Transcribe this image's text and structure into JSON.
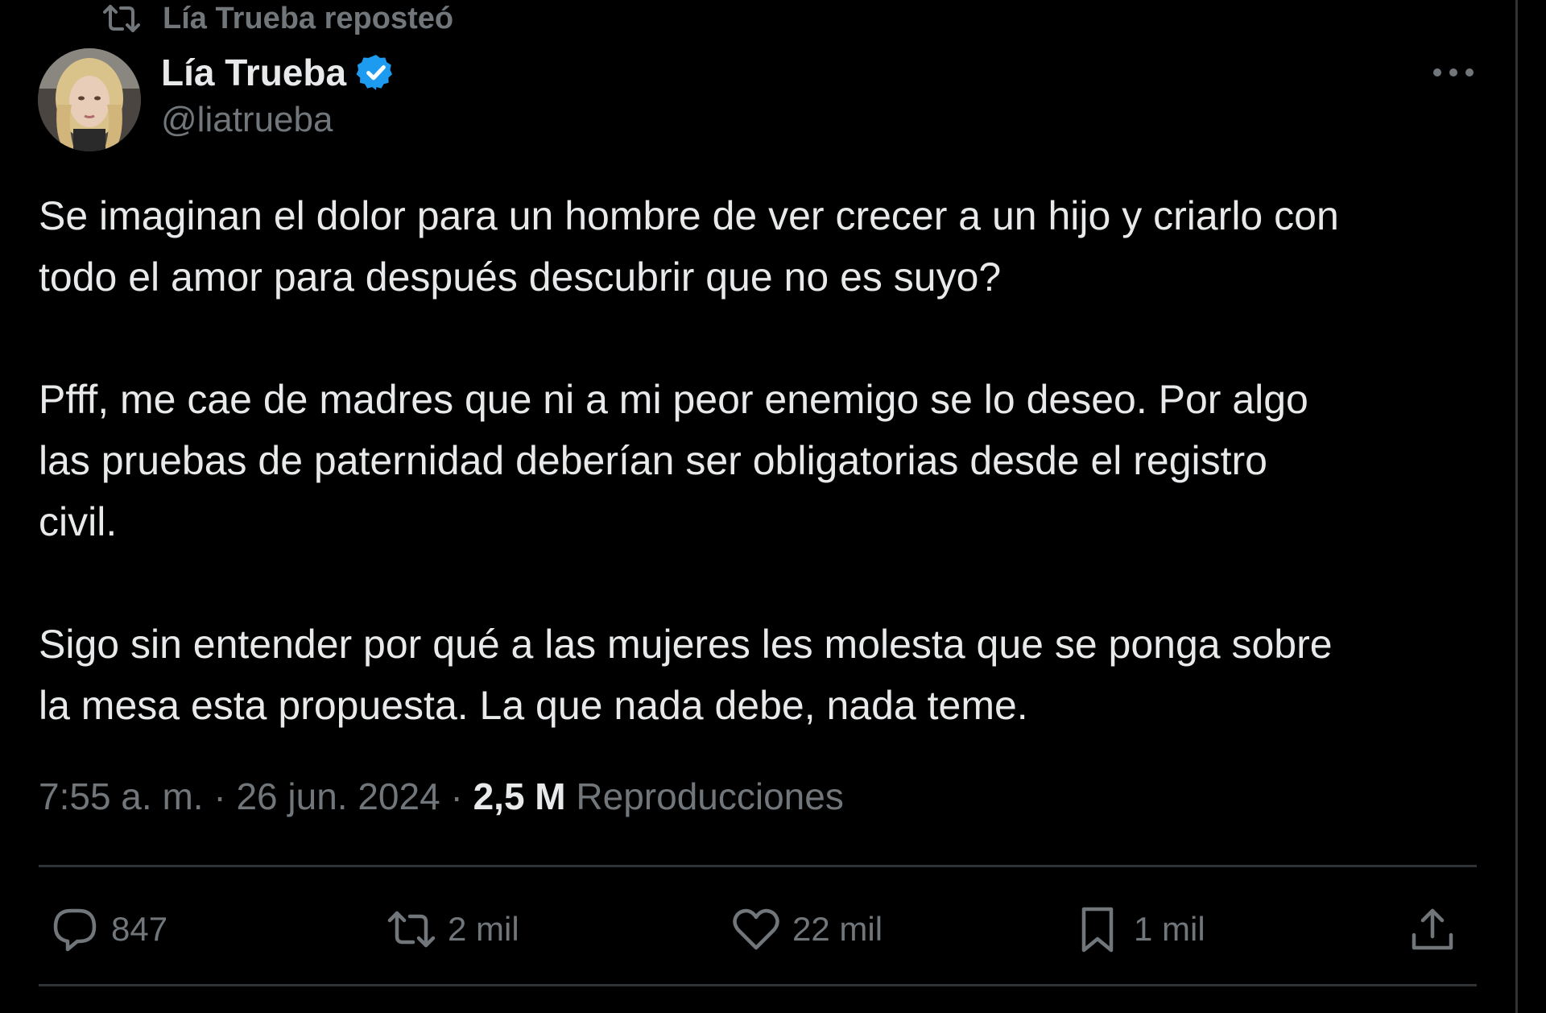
{
  "repost_header": {
    "text": "Lía Trueba reposteó",
    "icon": "repost-icon"
  },
  "author": {
    "name": "Lía Trueba",
    "handle": "@liatrueba",
    "verified": true,
    "verified_color": "#1d9bf0"
  },
  "tweet": {
    "paragraphs": [
      "Se imaginan el dolor para un hombre de ver crecer a un hijo y criarlo con\ntodo el amor para después descubrir que no es suyo?",
      "Pfff, me cae de madres que ni a mi peor enemigo se lo deseo. Por algo\nlas pruebas de paternidad deberían ser obligatorias desde el registro\ncivil.",
      "Sigo sin entender por qué a las mujeres les molesta que se ponga sobre\nla mesa esta propuesta. La que nada debe, nada teme."
    ]
  },
  "meta": {
    "time": "7:55 a. m.",
    "separator": "·",
    "date": "26 jun. 2024",
    "views_count": "2,5 M",
    "views_label": "Reproducciones"
  },
  "actions": {
    "replies": "847",
    "reposts": "2 mil",
    "likes": "22 mil",
    "bookmarks": "1 mil"
  },
  "colors": {
    "background": "#000000",
    "text_primary": "#e7e9ea",
    "text_secondary": "#71767b",
    "divider": "#2f3336",
    "accent": "#1d9bf0"
  }
}
